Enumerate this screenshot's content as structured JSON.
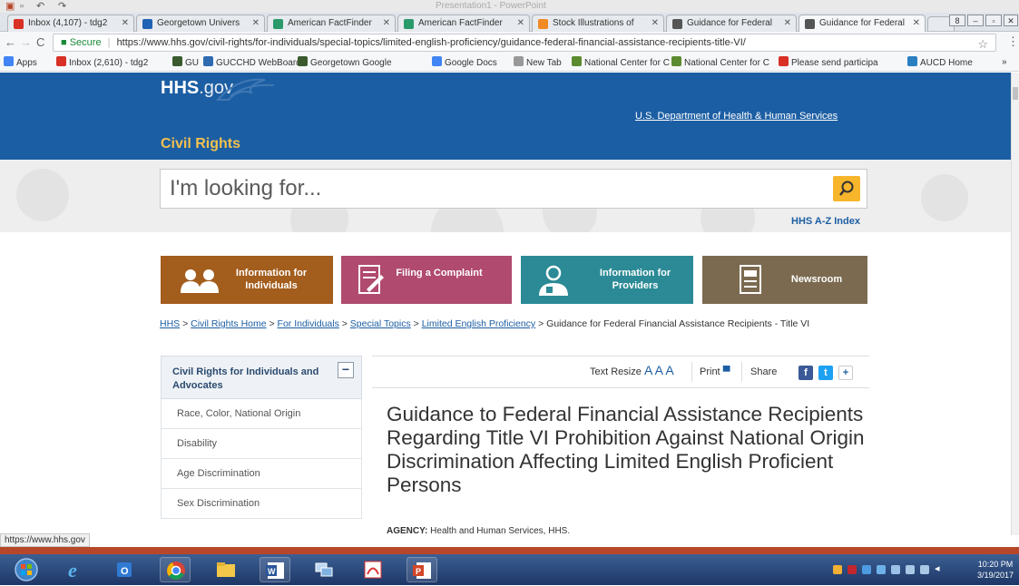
{
  "powerpoint": {
    "document_title": "Presentation1 - PowerPoint"
  },
  "browser": {
    "tabs": [
      {
        "label": "Inbox (4,107) - tdg2",
        "favicon": "gmail-icon",
        "color": "#d93025",
        "active": false
      },
      {
        "label": "Georgetown Univers",
        "favicon": "georgetown-icon",
        "color": "#1f63b5",
        "active": false
      },
      {
        "label": "American FactFinder",
        "favicon": "factfinder-icon",
        "color": "#2a9a6b",
        "active": false
      },
      {
        "label": "American FactFinder",
        "favicon": "factfinder-icon",
        "color": "#2a9a6b",
        "active": false
      },
      {
        "label": "Stock Illustrations of",
        "favicon": "stock-icon",
        "color": "#f08a24",
        "active": false
      },
      {
        "label": "Guidance for Federal",
        "favicon": "hhs-eagle-icon",
        "color": "#555555",
        "active": false
      },
      {
        "label": "Guidance for Federal",
        "favicon": "hhs-eagle-icon",
        "color": "#555555",
        "active": true
      }
    ],
    "secure_label": "Secure",
    "url": "https://www.hhs.gov/civil-rights/for-individuals/special-topics/limited-english-proficiency/guidance-federal-financial-assistance-recipients-title-VI/",
    "bookmarks": [
      {
        "label": "Apps",
        "icon": "apps-grid-icon",
        "color": "#4285f4"
      },
      {
        "label": "Inbox (2,610) - tdg2",
        "icon": "gmail-icon",
        "color": "#d93025"
      },
      {
        "label": "GU",
        "icon": "gu-icon",
        "color": "#3b5b2f"
      },
      {
        "label": "GUCCHD WebBoard",
        "icon": "gucchd-icon",
        "color": "#2e6ab0"
      },
      {
        "label": "Georgetown Google",
        "icon": "gu-icon",
        "color": "#3b5b2f"
      },
      {
        "label": "Google Docs",
        "icon": "docs-icon",
        "color": "#4285f4"
      },
      {
        "label": "New Tab",
        "icon": "page-icon",
        "color": "#999999"
      },
      {
        "label": "National Center for C",
        "icon": "ne-icon",
        "color": "#5c8a2f"
      },
      {
        "label": "National Center for C",
        "icon": "ne-icon",
        "color": "#5c8a2f"
      },
      {
        "label": "Please send participa",
        "icon": "gmail-icon",
        "color": "#d93025"
      },
      {
        "label": "AUCD Home",
        "icon": "aucd-icon",
        "color": "#2a7fc0"
      }
    ],
    "more_bookmarks": "»",
    "status_url": "https://www.hhs.gov"
  },
  "page": {
    "logo_hhs": "HHS",
    "logo_gov": ".gov",
    "section_title": "Civil Rights",
    "dept_link": "U.S. Department of Health & Human Services",
    "search_placeholder": "I'm looking for...",
    "az_index": "HHS A-Z Index",
    "categories": [
      {
        "label": "Information for Individuals",
        "color": "#a35d1c",
        "icon": "people-icon"
      },
      {
        "label": "Filing a Complaint",
        "color": "#b04a6e",
        "icon": "document-pen-icon"
      },
      {
        "label": "Information for Providers",
        "color": "#2b8a96",
        "icon": "provider-icon"
      },
      {
        "label": "Newsroom",
        "color": "#7b6a50",
        "icon": "newspaper-icon"
      }
    ],
    "breadcrumb": {
      "links": [
        "HHS",
        "Civil Rights Home",
        "For Individuals",
        "Special Topics",
        "Limited English Proficiency"
      ],
      "current": "Guidance for Federal Financial Assistance Recipients - Title VI",
      "separator": ">"
    },
    "sidebar": {
      "heading": "Civil Rights for Individuals and Advocates",
      "toggle": "−",
      "items": [
        "Race, Color, National Origin",
        "Disability",
        "Age Discrimination",
        "Sex Discrimination"
      ]
    },
    "tools": {
      "text_resize": "Text Resize",
      "resize_glyphs": "A A A",
      "print": "Print",
      "share": "Share",
      "share_more": "+"
    },
    "title": "Guidance to Federal Financial Assistance Recipients Regarding Title VI Prohibition Against National Origin Discrimination Affecting Limited English Proficient Persons",
    "agency_label": "AGENCY:",
    "agency_value": "Health and Human Services, HHS."
  },
  "taskbar": {
    "apps": [
      "start-orb-icon",
      "internet-explorer-icon",
      "outlook-icon",
      "chrome-icon",
      "file-explorer-icon",
      "word-icon",
      "network-icon",
      "acrobat-icon",
      "powerpoint-icon"
    ],
    "time": "10:20 PM",
    "date": "3/19/2017"
  }
}
